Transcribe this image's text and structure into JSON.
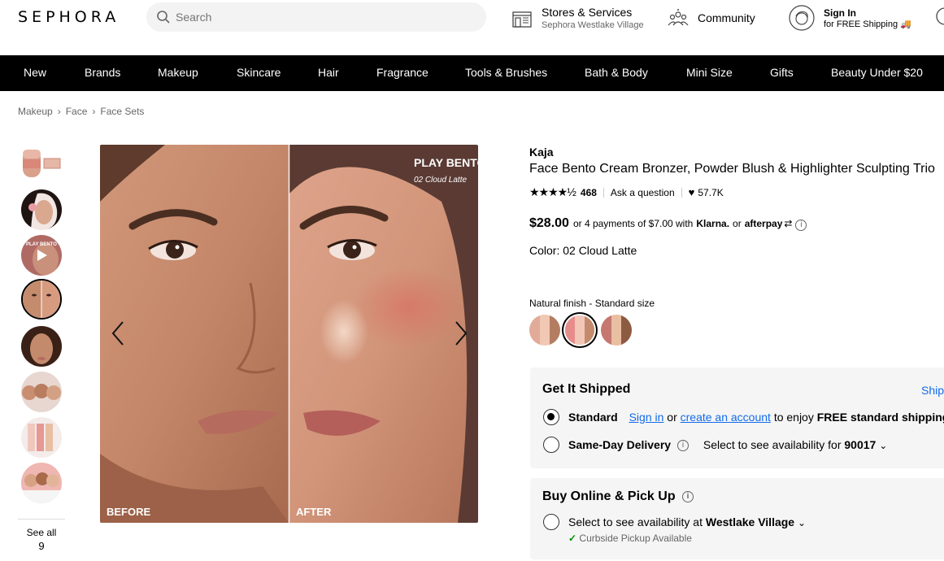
{
  "header": {
    "logo": "SEPHORA",
    "search_placeholder": "Search",
    "stores_title": "Stores & Services",
    "stores_sub": "Sephora Westlake Village",
    "community": "Community",
    "signin_title": "Sign In",
    "signin_sub": "for FREE Shipping 🚚"
  },
  "nav": [
    "New",
    "Brands",
    "Makeup",
    "Skincare",
    "Hair",
    "Fragrance",
    "Tools & Brushes",
    "Bath & Body",
    "Mini Size",
    "Gifts",
    "Beauty Under $20"
  ],
  "breadcrumb": [
    "Makeup",
    "Face",
    "Face Sets"
  ],
  "gallery": {
    "see_all": "See all",
    "count": "9",
    "thumb_video_label": "PLAY BENTO",
    "overlay_title": "PLAY BENTO",
    "overlay_shade": "02 Cloud Latte",
    "before_label": "BEFORE",
    "after_label": "AFTER"
  },
  "product": {
    "brand": "Kaja",
    "name": "Face Bento Cream Bronzer, Powder Blush & Highlighter Sculpting Trio",
    "stars": "★★★★½",
    "rating_value": 4.5,
    "reviews": "468",
    "ask": "Ask a question",
    "loves": "57.7K",
    "price": "$28.00",
    "installments": "or 4 payments of $7.00 with",
    "klarna": "Klarna.",
    "or": "or",
    "afterpay": "afterpay",
    "color_label": "Color: 02 Cloud Latte",
    "finish": "Natural finish - Standard size"
  },
  "shipping": {
    "title": "Get It Shipped",
    "ship_link": "Ship",
    "standard": "Standard",
    "sign_in": "Sign in",
    "or": "or",
    "create_account": "create an account",
    "enjoy": "to enjoy",
    "free_standard": "FREE standard shipping",
    "same_day": "Same-Day Delivery",
    "same_day_select": "Select to see availability for",
    "zip": "90017"
  },
  "pickup": {
    "title": "Buy Online & Pick Up",
    "select": "Select to see availability at",
    "store": "Westlake Village",
    "curbside": "Curbside Pickup Available"
  },
  "colors": {
    "nav_bg": "#000000",
    "link": "#136bea",
    "box_bg": "#f5f5f5",
    "check": "#008a00"
  }
}
